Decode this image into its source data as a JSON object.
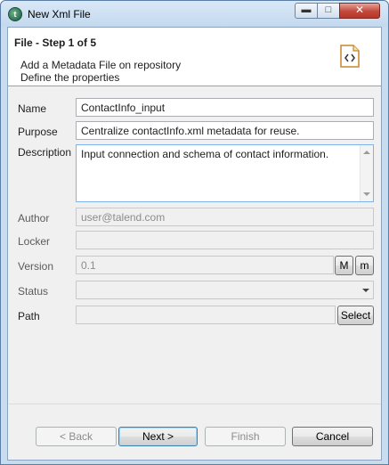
{
  "window": {
    "title": "New Xml File",
    "app_icon": "talend-icon",
    "controls": {
      "minimize": "minimize-icon",
      "maximize": "maximize-icon",
      "close": "close-icon"
    }
  },
  "header": {
    "title": "File - Step 1 of 5",
    "description_line1": "Add a Metadata File on repository",
    "description_line2": "Define the properties",
    "icon": "xml-file-icon"
  },
  "form": {
    "name": {
      "label": "Name",
      "value": "ContactInfo_input"
    },
    "purpose": {
      "label": "Purpose",
      "value": "Centralize contactInfo.xml metadata for reuse."
    },
    "description": {
      "label": "Description",
      "value": "Input connection and schema of contact information."
    },
    "author": {
      "label": "Author",
      "value": "user@talend.com"
    },
    "locker": {
      "label": "Locker",
      "value": ""
    },
    "version": {
      "label": "Version",
      "value": "0.1",
      "major_button": "M",
      "minor_button": "m"
    },
    "status": {
      "label": "Status",
      "value": ""
    },
    "path": {
      "label": "Path",
      "value": "",
      "select_button": "Select"
    }
  },
  "footer": {
    "back": "< Back",
    "next": "Next >",
    "finish": "Finish",
    "cancel": "Cancel"
  }
}
